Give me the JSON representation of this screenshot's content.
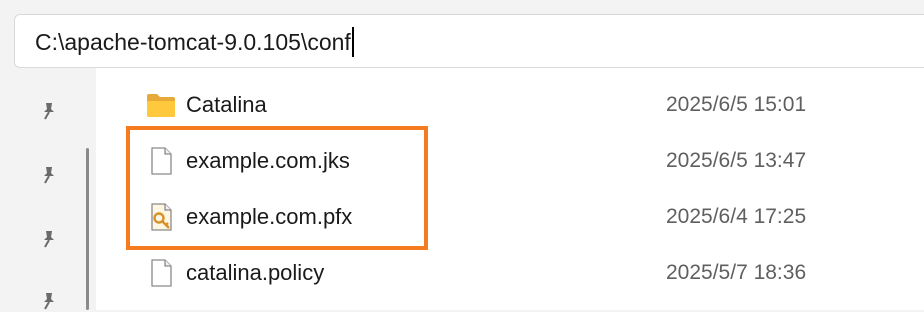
{
  "address_bar": {
    "path": "C:\\apache-tomcat-9.0.105\\conf"
  },
  "nav_pane": {
    "pinned_icon": "pin-icon"
  },
  "files": [
    {
      "name": "Catalina",
      "modified": "2025/6/5 15:01",
      "icon": "folder-icon"
    },
    {
      "name": "example.com.jks",
      "modified": "2025/6/5 13:47",
      "icon": "file-icon"
    },
    {
      "name": "example.com.pfx",
      "modified": "2025/6/4 17:25",
      "icon": "certificate-file-icon"
    },
    {
      "name": "catalina.policy",
      "modified": "2025/5/7 18:36",
      "icon": "file-icon"
    }
  ],
  "annotation": {
    "highlighted_files": [
      "example.com.jks",
      "example.com.pfx"
    ],
    "color": "#f47b20"
  }
}
